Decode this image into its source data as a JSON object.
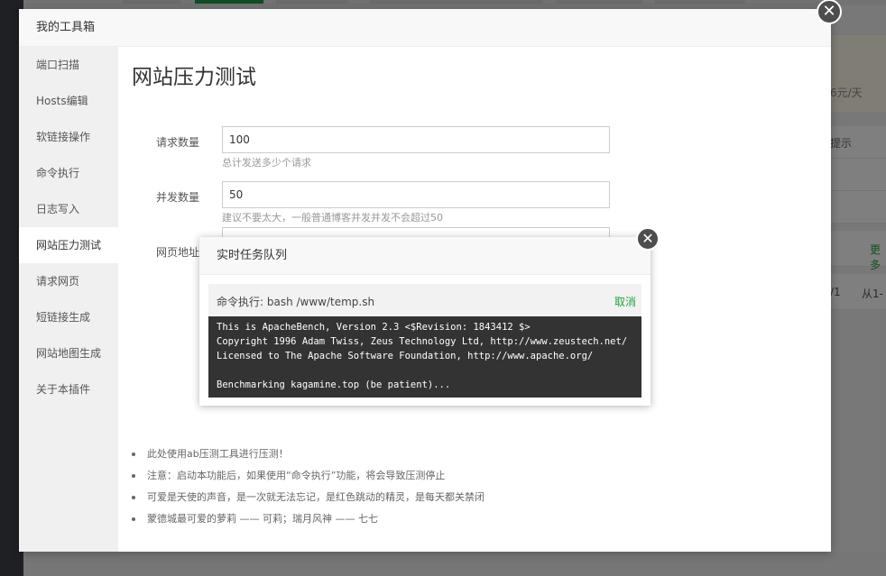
{
  "background": {
    "price_text": "6元/天",
    "hint_text": "提示",
    "more_link": "更多",
    "pagination_a": "/1",
    "pagination_b": "从1-"
  },
  "dialog": {
    "title": "我的工具箱",
    "close_glyph": "✕",
    "sidebar": [
      {
        "label": "端口扫描"
      },
      {
        "label": "Hosts编辑"
      },
      {
        "label": "软链接操作"
      },
      {
        "label": "命令执行"
      },
      {
        "label": "日志写入"
      },
      {
        "label": "网站压力测试"
      },
      {
        "label": "请求网页"
      },
      {
        "label": "短链接生成"
      },
      {
        "label": "网站地图生成"
      },
      {
        "label": "关于本插件"
      }
    ],
    "active_index": 5,
    "page_title": "网站压力测试",
    "form": {
      "requests": {
        "label": "请求数量",
        "value": "100",
        "hint": "总计发送多少个请求"
      },
      "concurrency": {
        "label": "并发数量",
        "value": "50",
        "hint": "建议不要太大，一般普通博客并发并发不会超过50"
      },
      "url": {
        "label": "网页地址"
      }
    },
    "tips": [
      "此处使用ab压测工具进行压测！",
      "注意：启动本功能后，如果使用“命令执行”功能，将会导致压测停止",
      "可爱是天使的声音，是一次就无法忘记，是红色跳动的精灵，是每天都关禁闭",
      "蒙德城最可爱的萝莉 —— 可莉；瑞月风神 —— 七七"
    ]
  },
  "queue": {
    "title": "实时任务队列",
    "close_glyph": "✕",
    "task_text": "命令执行: bash /www/temp.sh",
    "cancel_label": "取消",
    "terminal_lines": [
      "This is ApacheBench, Version 2.3 <$Revision: 1843412 $>",
      "Copyright 1996 Adam Twiss, Zeus Technology Ltd, http://www.zeustech.net/",
      "Licensed to The Apache Software Foundation, http://www.apache.org/",
      "",
      "Benchmarking kagamine.top (be patient)..."
    ]
  },
  "colors": {
    "accent": "#20a53a",
    "terminal_bg": "#333333",
    "sidebar_bg": "#f0f0f0"
  }
}
